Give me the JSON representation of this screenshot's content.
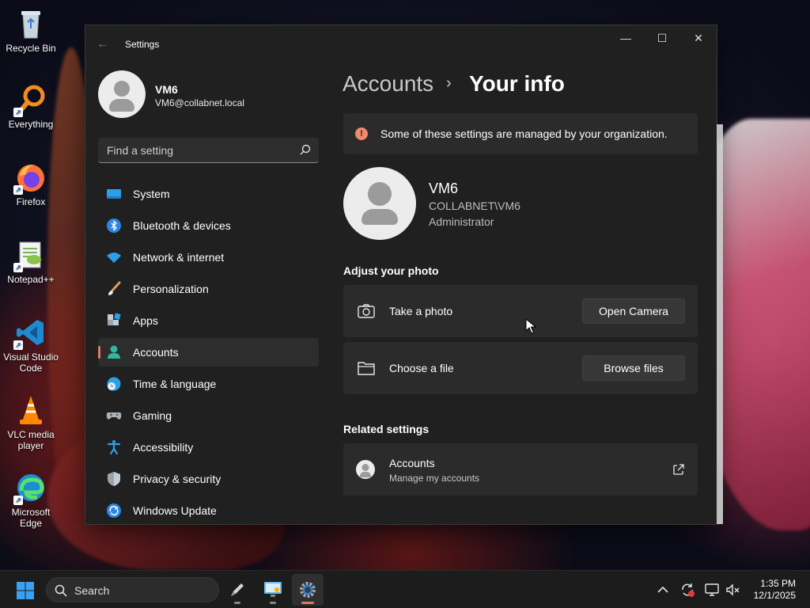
{
  "desktop": {
    "icons": [
      {
        "label": "Recycle Bin"
      },
      {
        "label": "Everything"
      },
      {
        "label": "Firefox"
      },
      {
        "label": "Notepad++"
      },
      {
        "label": "Visual Studio Code"
      },
      {
        "label": "VLC media player"
      },
      {
        "label": "Microsoft Edge"
      }
    ]
  },
  "window": {
    "app_title": "Settings",
    "buttons": {
      "minimize": "—",
      "maximize": "☐",
      "close": "✕"
    }
  },
  "sidebar": {
    "profile": {
      "name": "VM6",
      "email": "VM6@collabnet.local"
    },
    "search": {
      "placeholder": "Find a setting"
    },
    "items": [
      {
        "label": "System",
        "icon": "system-icon"
      },
      {
        "label": "Bluetooth & devices",
        "icon": "bluetooth-icon"
      },
      {
        "label": "Network & internet",
        "icon": "wifi-icon"
      },
      {
        "label": "Personalization",
        "icon": "brush-icon"
      },
      {
        "label": "Apps",
        "icon": "apps-icon"
      },
      {
        "label": "Accounts",
        "icon": "accounts-icon",
        "active": true
      },
      {
        "label": "Time & language",
        "icon": "globe-icon"
      },
      {
        "label": "Gaming",
        "icon": "controller-icon"
      },
      {
        "label": "Accessibility",
        "icon": "accessibility-icon"
      },
      {
        "label": "Privacy & security",
        "icon": "shield-icon"
      },
      {
        "label": "Windows Update",
        "icon": "update-icon"
      }
    ]
  },
  "main": {
    "breadcrumb": {
      "parent": "Accounts",
      "separator": "›",
      "current": "Your info"
    },
    "info_bar": {
      "icon_glyph": "!",
      "text": "Some of these settings are managed by your organization."
    },
    "user": {
      "name": "VM6",
      "domain": "COLLABNET\\VM6",
      "role": "Administrator"
    },
    "adjust_photo": {
      "title": "Adjust your photo",
      "take_photo": {
        "label": "Take a photo",
        "button": "Open Camera"
      },
      "choose_file": {
        "label": "Choose a file",
        "button": "Browse files"
      }
    },
    "related": {
      "title": "Related settings",
      "accounts": {
        "title": "Accounts",
        "subtitle": "Manage my accounts"
      }
    }
  },
  "taskbar": {
    "search_label": "Search",
    "clock": {
      "time": "1:35 PM",
      "date": "12/1/2025"
    }
  },
  "colors": {
    "accent": "#e07a5f",
    "window_bg": "#202020",
    "card_bg": "#2b2b2b",
    "info_icon": "#f08a6e"
  }
}
